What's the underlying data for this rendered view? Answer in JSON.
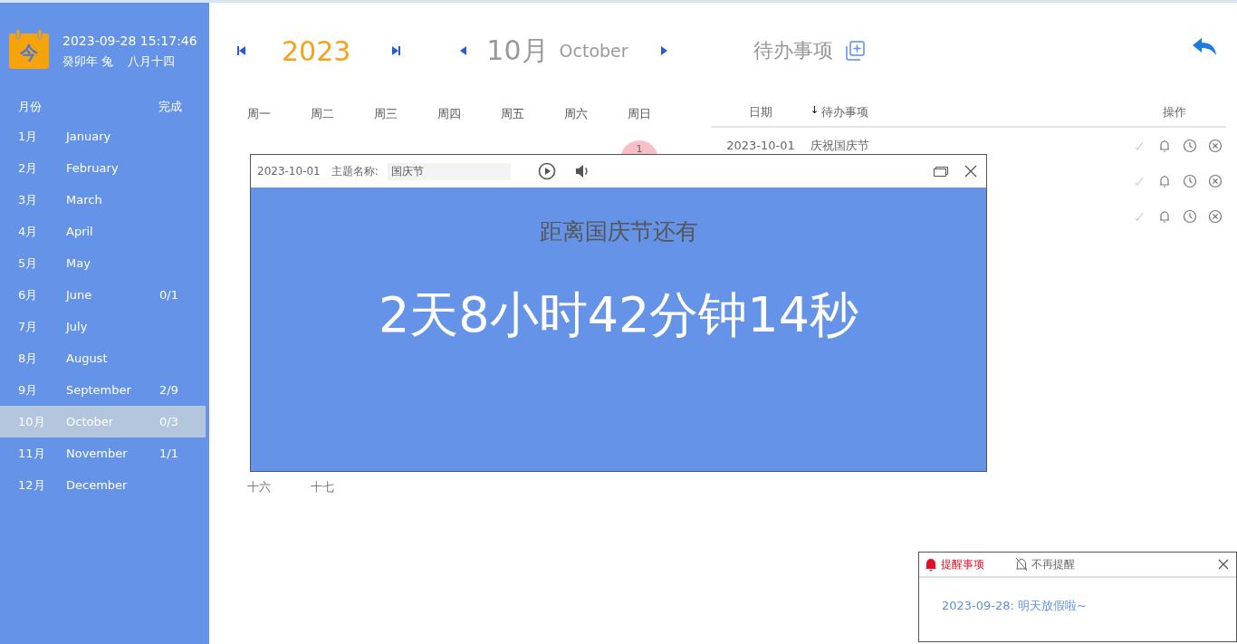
{
  "clock": {
    "icon_char": "今",
    "datetime": "2023-09-28 15:17:46",
    "lunar_year": "癸卯年 兔",
    "lunar_date": "八月十四"
  },
  "months_header": {
    "month": "月份",
    "done": "完成"
  },
  "months": [
    {
      "num": "1月",
      "name": "January",
      "selected": false
    },
    {
      "num": "2月",
      "name": "February",
      "selected": false
    },
    {
      "num": "3月",
      "name": "March",
      "selected": false
    },
    {
      "num": "4月",
      "name": "April",
      "selected": false
    },
    {
      "num": "5月",
      "name": "May",
      "selected": false
    },
    {
      "num": "6月",
      "name": "June",
      "done": "0/1",
      "selected": false
    },
    {
      "num": "7月",
      "name": "July",
      "selected": false
    },
    {
      "num": "8月",
      "name": "August",
      "selected": false
    },
    {
      "num": "9月",
      "name": "September",
      "done": "2/9",
      "selected": false
    },
    {
      "num": "10月",
      "name": "October",
      "done": "0/3",
      "selected": true
    },
    {
      "num": "11月",
      "name": "November",
      "done": "1/1",
      "selected": false
    },
    {
      "num": "12月",
      "name": "December",
      "selected": false
    }
  ],
  "nav": {
    "year": "2023",
    "month": "10月",
    "month_en": "October"
  },
  "weekdays": [
    "周一",
    "周二",
    "周三",
    "周四",
    "周五",
    "周六",
    "周日"
  ],
  "calendar": {
    "first_day": "1",
    "lunar_labels": [
      "十六",
      "十七"
    ]
  },
  "todo": {
    "title": "待办事项",
    "columns": {
      "date": "日期",
      "sort_arrow": "↓",
      "item": "待办事项",
      "actions": "操作"
    },
    "rows": [
      {
        "kind": "shown",
        "date": "2023-10-01",
        "item": "庆祝国庆节"
      },
      {
        "kind": "covered"
      },
      {
        "kind": "covered"
      }
    ]
  },
  "popup": {
    "date": "2023-10-01",
    "topic_label": "主题名称:",
    "topic": "国庆节",
    "heading": "距离国庆节还有",
    "countdown": "2天8小时42分钟14秒"
  },
  "reminder": {
    "tab": "提醒事项",
    "mute": "不再提醒",
    "message": "2023-09-28: 明天放假啦~"
  }
}
